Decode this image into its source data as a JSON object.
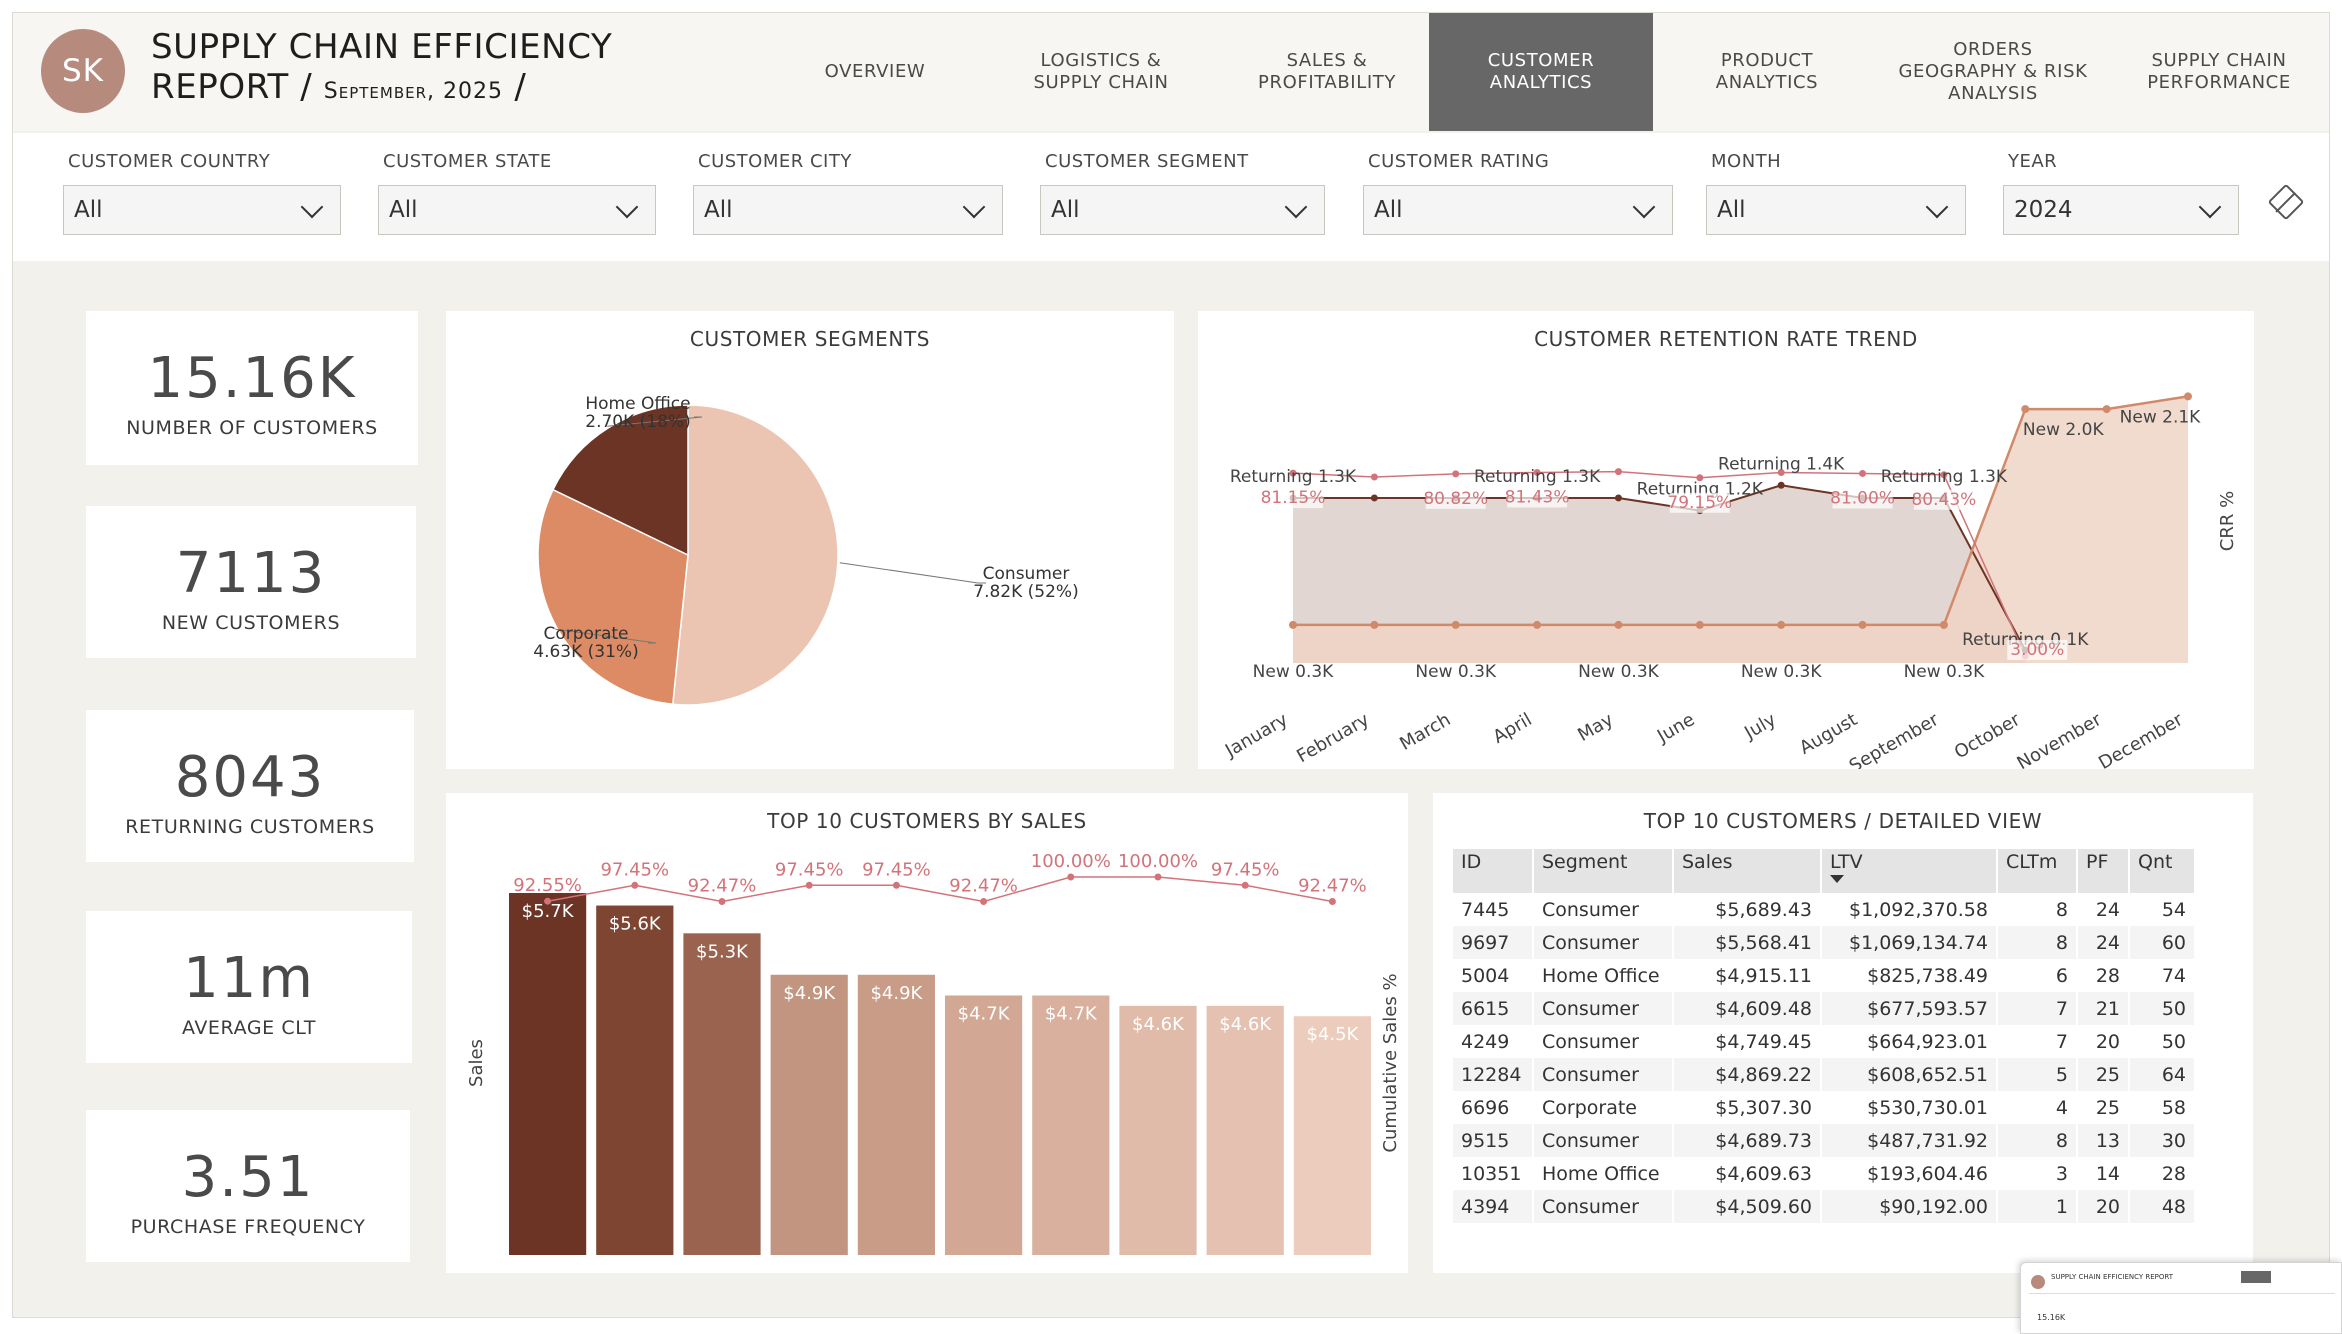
{
  "header": {
    "avatar_initials": "SK",
    "title_line1": "SUPPLY CHAIN EFFICIENCY",
    "title_line2_prefix": "REPORT / ",
    "title_date": "September, 2025",
    "title_suffix": " /"
  },
  "tabs": [
    {
      "label": "OVERVIEW",
      "active": false
    },
    {
      "label": "LOGISTICS & SUPPLY CHAIN",
      "active": false
    },
    {
      "label": "SALES & PROFITABILITY",
      "active": false
    },
    {
      "label": "CUSTOMER ANALYTICS",
      "active": true
    },
    {
      "label": "PRODUCT ANALYTICS",
      "active": false
    },
    {
      "label": "ORDERS GEOGRAPHY & RISK ANALYSIS",
      "active": false
    },
    {
      "label": "SUPPLY CHAIN PERFORMANCE",
      "active": false
    }
  ],
  "filters": [
    {
      "label": "CUSTOMER COUNTRY",
      "value": "All"
    },
    {
      "label": "CUSTOMER STATE",
      "value": "All"
    },
    {
      "label": "CUSTOMER CITY",
      "value": "All"
    },
    {
      "label": "CUSTOMER SEGMENT",
      "value": "All"
    },
    {
      "label": "CUSTOMER RATING",
      "value": "All"
    },
    {
      "label": "MONTH",
      "value": "All"
    },
    {
      "label": "YEAR",
      "value": "2024"
    }
  ],
  "kpis": [
    {
      "value": "15.16K",
      "label": "NUMBER OF CUSTOMERS"
    },
    {
      "value": "7113",
      "label": "NEW CUSTOMERS"
    },
    {
      "value": "8043",
      "label": "RETURNING CUSTOMERS"
    },
    {
      "value": "11m",
      "label": "AVERAGE CLT"
    },
    {
      "value": "3.51",
      "label": "PURCHASE FREQUENCY"
    }
  ],
  "colors": {
    "accent_dark": "#6b3424",
    "pie_consumer": "#ecc5b2",
    "pie_corporate": "#dc8b65",
    "pie_home_office": "#6b3424",
    "line_pink": "#d2737a",
    "active_tab": "#676767"
  },
  "chart_data": [
    {
      "type": "pie",
      "title": "CUSTOMER SEGMENTS",
      "slices": [
        {
          "name": "Consumer",
          "value": 7.82,
          "label": "7.82K (52%)",
          "percent": 52
        },
        {
          "name": "Corporate",
          "value": 4.63,
          "label": "4.63K (31%)",
          "percent": 31
        },
        {
          "name": "Home Office",
          "value": 2.7,
          "label": "2.70K (18%)",
          "percent": 18
        }
      ]
    },
    {
      "type": "area",
      "title": "CUSTOMER RETENTION RATE TREND",
      "ylabel_right": "CRR %",
      "x": [
        "January",
        "February",
        "March",
        "April",
        "May",
        "June",
        "July",
        "August",
        "September",
        "October",
        "November",
        "December"
      ],
      "series": [
        {
          "name": "Returning",
          "values": [
            1.3,
            1.3,
            1.3,
            1.3,
            1.3,
            1.2,
            1.4,
            1.3,
            1.3,
            0.1,
            0.0,
            0.0
          ]
        },
        {
          "name": "New",
          "values": [
            0.3,
            0.3,
            0.3,
            0.3,
            0.3,
            0.3,
            0.3,
            0.3,
            0.3,
            2.0,
            2.0,
            2.1
          ]
        },
        {
          "name": "CRR %",
          "values": [
            81.15,
            79.5,
            80.82,
            81.43,
            81.8,
            79.15,
            81.4,
            81.0,
            80.43,
            3.0,
            null,
            null
          ]
        }
      ],
      "point_labels": [
        {
          "text": "Returning 1.3K",
          "month": "January"
        },
        {
          "text": "Returning 1.3K",
          "month": "April"
        },
        {
          "text": "Returning 1.2K",
          "month": "June"
        },
        {
          "text": "Returning 1.4K",
          "month": "July"
        },
        {
          "text": "Returning 1.3K",
          "month": "September"
        },
        {
          "text": "Returning 0.1K",
          "month": "October"
        },
        {
          "text": "New 0.3K",
          "month": "January"
        },
        {
          "text": "New 0.3K",
          "month": "March"
        },
        {
          "text": "New 0.3K",
          "month": "May"
        },
        {
          "text": "New 0.3K",
          "month": "July"
        },
        {
          "text": "New 0.3K",
          "month": "September"
        },
        {
          "text": "New 2.0K",
          "month": "October"
        },
        {
          "text": "New 2.1K",
          "month": "December"
        }
      ],
      "crr_labels": [
        {
          "text": "81.15%",
          "month": "January"
        },
        {
          "text": "80.82%",
          "month": "March"
        },
        {
          "text": "81.43%",
          "month": "April"
        },
        {
          "text": "79.15%",
          "month": "June"
        },
        {
          "text": "81.00%",
          "month": "August"
        },
        {
          "text": "80.43%",
          "month": "September"
        },
        {
          "text": "3.00%",
          "month": "October"
        }
      ]
    },
    {
      "type": "bar",
      "title": "TOP 10 CUSTOMERS BY SALES",
      "ylabel": "Sales",
      "ylabel_right": "Cumulative Sales %",
      "values": [
        5.689,
        5.568,
        5.3,
        4.9,
        4.9,
        4.7,
        4.7,
        4.6,
        4.6,
        4.5
      ],
      "value_labels": [
        "$5.7K",
        "$5.6K",
        "$5.3K",
        "$4.9K",
        "$4.9K",
        "$4.7K",
        "$4.7K",
        "$4.6K",
        "$4.6K",
        "$4.5K"
      ],
      "cumulative_pct": [
        92.55,
        97.45,
        92.47,
        97.45,
        97.45,
        92.47,
        100.0,
        100.0,
        97.45,
        92.47
      ],
      "cumulative_labels": [
        "92.55%",
        "97.45%",
        "92.47%",
        "97.45%",
        "97.45%",
        "92.47%",
        "100.00%",
        "100.00%",
        "97.45%",
        "92.47%"
      ],
      "bar_colors": [
        "#6b3424",
        "#7e4532",
        "#9a6350",
        "#c29580",
        "#c89c87",
        "#d2a793",
        "#d8b09d",
        "#e0bba9",
        "#e4c1b0",
        "#ecccbc"
      ]
    }
  ],
  "table": {
    "title": "TOP 10 CUSTOMERS / DETAILED VIEW",
    "columns": [
      "ID",
      "Segment",
      "Sales",
      "LTV",
      "CLTm",
      "PF",
      "Qnt"
    ],
    "rows": [
      [
        "7445",
        "Consumer",
        "$5,689.43",
        "$1,092,370.58",
        "8",
        "24",
        "54"
      ],
      [
        "9697",
        "Consumer",
        "$5,568.41",
        "$1,069,134.74",
        "8",
        "24",
        "60"
      ],
      [
        "5004",
        "Home Office",
        "$4,915.11",
        "$825,738.49",
        "6",
        "28",
        "74"
      ],
      [
        "6615",
        "Consumer",
        "$4,609.48",
        "$677,593.57",
        "7",
        "21",
        "50"
      ],
      [
        "4249",
        "Consumer",
        "$4,749.45",
        "$664,923.01",
        "7",
        "20",
        "50"
      ],
      [
        "12284",
        "Consumer",
        "$4,869.22",
        "$608,652.51",
        "5",
        "25",
        "64"
      ],
      [
        "6696",
        "Corporate",
        "$5,307.30",
        "$530,730.01",
        "4",
        "25",
        "58"
      ],
      [
        "9515",
        "Consumer",
        "$4,689.73",
        "$487,731.92",
        "8",
        "13",
        "30"
      ],
      [
        "10351",
        "Home Office",
        "$4,609.63",
        "$193,604.46",
        "3",
        "14",
        "28"
      ],
      [
        "4394",
        "Consumer",
        "$4,509.60",
        "$90,192.00",
        "1",
        "20",
        "48"
      ]
    ]
  },
  "thumbnail": {
    "title": "SUPPLY CHAIN EFFICIENCY REPORT",
    "kpi": "15.16K"
  }
}
